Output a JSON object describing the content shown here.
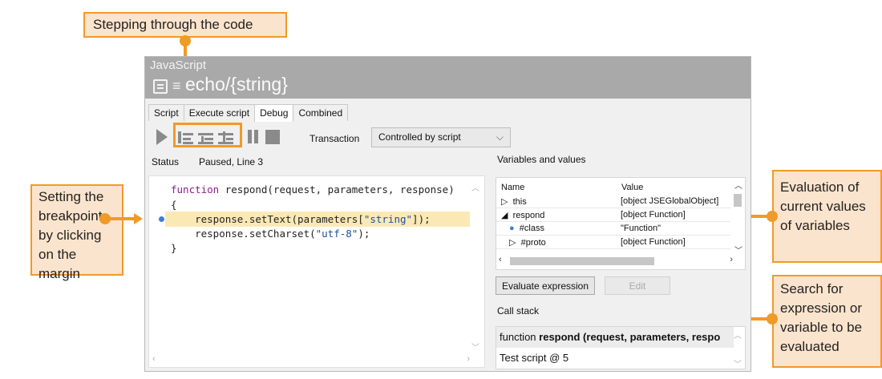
{
  "window": {
    "language": "JavaScript",
    "title": "echo/{string}",
    "menu_glyph": "≡"
  },
  "tabs": [
    {
      "label": "Script",
      "active": false
    },
    {
      "label": "Execute script",
      "active": false
    },
    {
      "label": "Debug",
      "active": true
    },
    {
      "label": "Combined",
      "active": false
    }
  ],
  "toolbar": {
    "icons": [
      "run-icon",
      "step-over-icon",
      "step-into-icon",
      "step-out-icon",
      "pause-icon",
      "stop-icon"
    ],
    "transaction_label": "Transaction",
    "transaction_value": "Controlled by script"
  },
  "status": {
    "label": "Status",
    "value": "Paused, Line 3"
  },
  "code": {
    "lines": [
      {
        "kw": "function",
        "text": " respond(request, parameters, response)"
      },
      {
        "text": "{"
      },
      {
        "pre": "    response.setText(parameters[",
        "str": "\"string\"",
        "post": "]);"
      },
      {
        "pre": "    response.setCharset(",
        "str": "\"utf-8\"",
        "post": ");"
      },
      {
        "text": "}"
      }
    ],
    "breakpoint_line": 3
  },
  "variables": {
    "section_label": "Variables and values",
    "col_name": "Name",
    "col_value": "Value",
    "rows": [
      {
        "glyph": "▷",
        "name": "this",
        "value": "[object JSEGlobalObject]"
      },
      {
        "glyph": "◢",
        "name": "respond",
        "value": "[object Function]"
      },
      {
        "glyph": "●",
        "name": "#class",
        "value": "\"Function\""
      },
      {
        "glyph": "▷",
        "name": "#proto",
        "value": "[object Function]"
      }
    ]
  },
  "buttons": {
    "evaluate": "Evaluate expression",
    "edit": "Edit"
  },
  "callstack": {
    "label": "Call stack",
    "prefix": "function ",
    "bold": "respond (request, parameters, respo",
    "entry2": "Test script @ 5"
  },
  "annotations": {
    "stepping": "Stepping through the code",
    "breakpoint": "Setting the breakpoint by clicking on the margin",
    "evaluation": "Evaluation of current values of variables",
    "search": "Search for expression or variable to be evaluated"
  },
  "colors": {
    "accent": "#f09a28",
    "annotation_fill": "#fbe4cd",
    "header_gray": "#a9a9a9",
    "highlight_line": "#fbe9b5",
    "breakpoint": "#3d7fd6"
  }
}
